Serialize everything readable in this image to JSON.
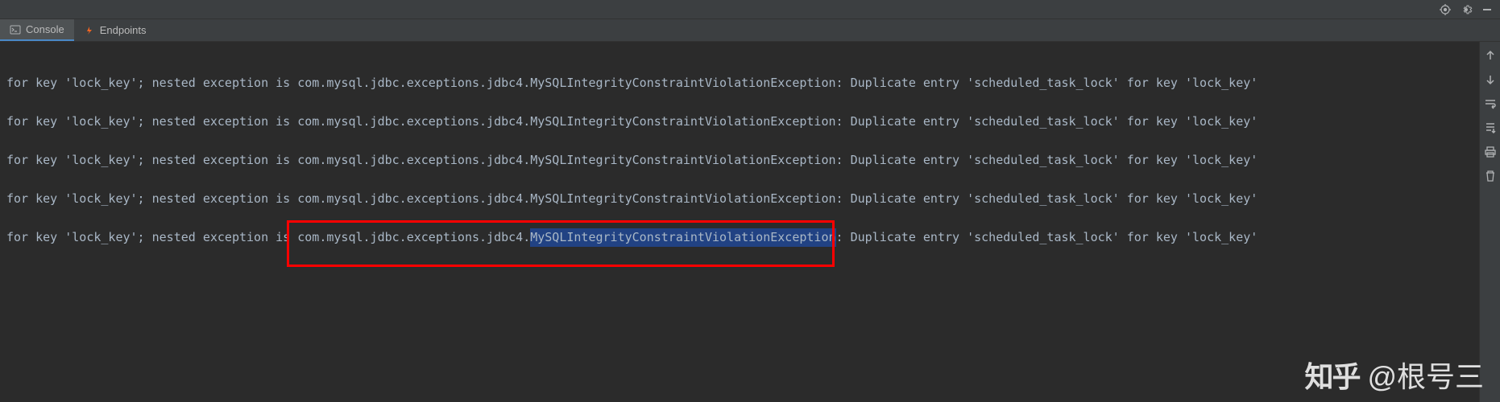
{
  "tabs": {
    "console": "Console",
    "endpoints": "Endpoints"
  },
  "log": {
    "prefix": "for key 'lock_key'; nested exception is ",
    "exception_class": "com.mysql.jdbc.exceptions.jdbc4.",
    "exception_name": "MySQLIntegrityConstraintViolationException",
    "suffix": ": Duplicate entry 'scheduled_task_lock' for key 'lock_key'"
  },
  "watermark": {
    "logo": "知乎",
    "text": "@根号三"
  }
}
